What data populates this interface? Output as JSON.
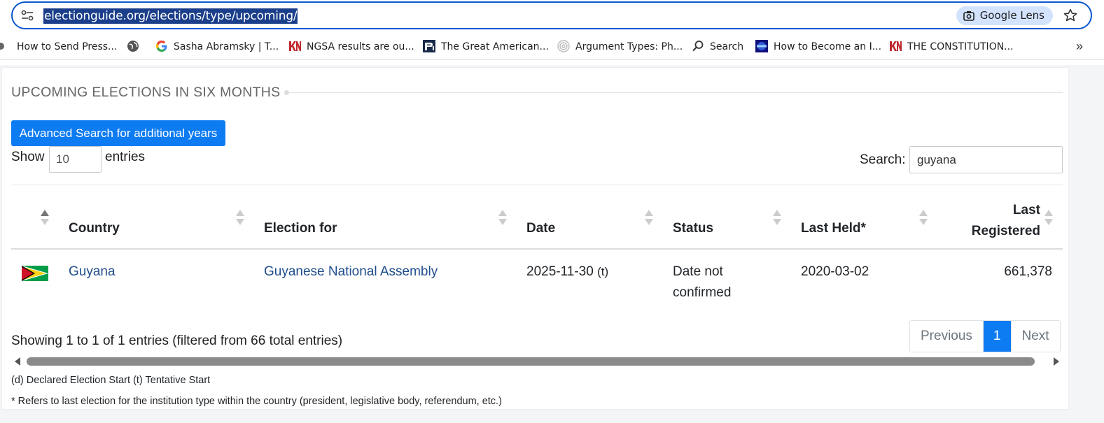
{
  "browser": {
    "url": "electionguide.org/elections/type/upcoming/",
    "lens_label": "Google Lens",
    "bookmarks": [
      {
        "label": "How to Send Press...",
        "icon": "send-icon"
      },
      {
        "label": "",
        "icon": "globe-icon"
      },
      {
        "label": "Sasha Abramsky | T...",
        "icon": "google-icon"
      },
      {
        "label": "NGSA results are ou...",
        "icon": "kn-logo-icon"
      },
      {
        "label": "The Great American...",
        "icon": "pi-logo-icon"
      },
      {
        "label": "Argument Types: Ph...",
        "icon": "spiral-icon"
      },
      {
        "label": "Search",
        "icon": "search-icon"
      },
      {
        "label": "How to Become an I...",
        "icon": "www-logo-icon"
      },
      {
        "label": "THE CONSTITUTION...",
        "icon": "kn-logo-icon"
      }
    ],
    "more_label": "»"
  },
  "page": {
    "section_title": "UPCOMING ELECTIONS IN SIX MONTHS",
    "advanced_search_label": "Advanced Search for additional years",
    "show_label": "Show",
    "entries_value": "10",
    "entries_label": "entries",
    "search_label": "Search:",
    "search_value": "guyana"
  },
  "table": {
    "headers": {
      "country": "Country",
      "election_for": "Election for",
      "date": "Date",
      "status": "Status",
      "last_held": "Last Held*",
      "last_registered_1": "Last",
      "last_registered_2": "Registered"
    },
    "rows": [
      {
        "flag": "guyana-flag-icon",
        "country": "Guyana",
        "election_for": "Guyanese National Assembly",
        "date": "2025-11-30",
        "date_flag": "(t)",
        "status_1": "Date not",
        "status_2": "confirmed",
        "last_held": "2020-03-02",
        "last_registered": "661,378"
      }
    ],
    "info": "Showing 1 to 1 of 1 entries (filtered from 66 total entries)",
    "pagination": {
      "previous": "Previous",
      "current": "1",
      "next": "Next"
    }
  },
  "notes": {
    "legend": "(d) Declared Election Start (t) Tentative Start",
    "footnote": "* Refers to last election for the institution type within the country (president, legislative body, referendum, etc.)"
  },
  "colors": {
    "accent": "#0d7bf2",
    "link": "#1f4e8c",
    "omnibox_border": "#0b57d0",
    "lens_pill": "#d3e3fd"
  }
}
